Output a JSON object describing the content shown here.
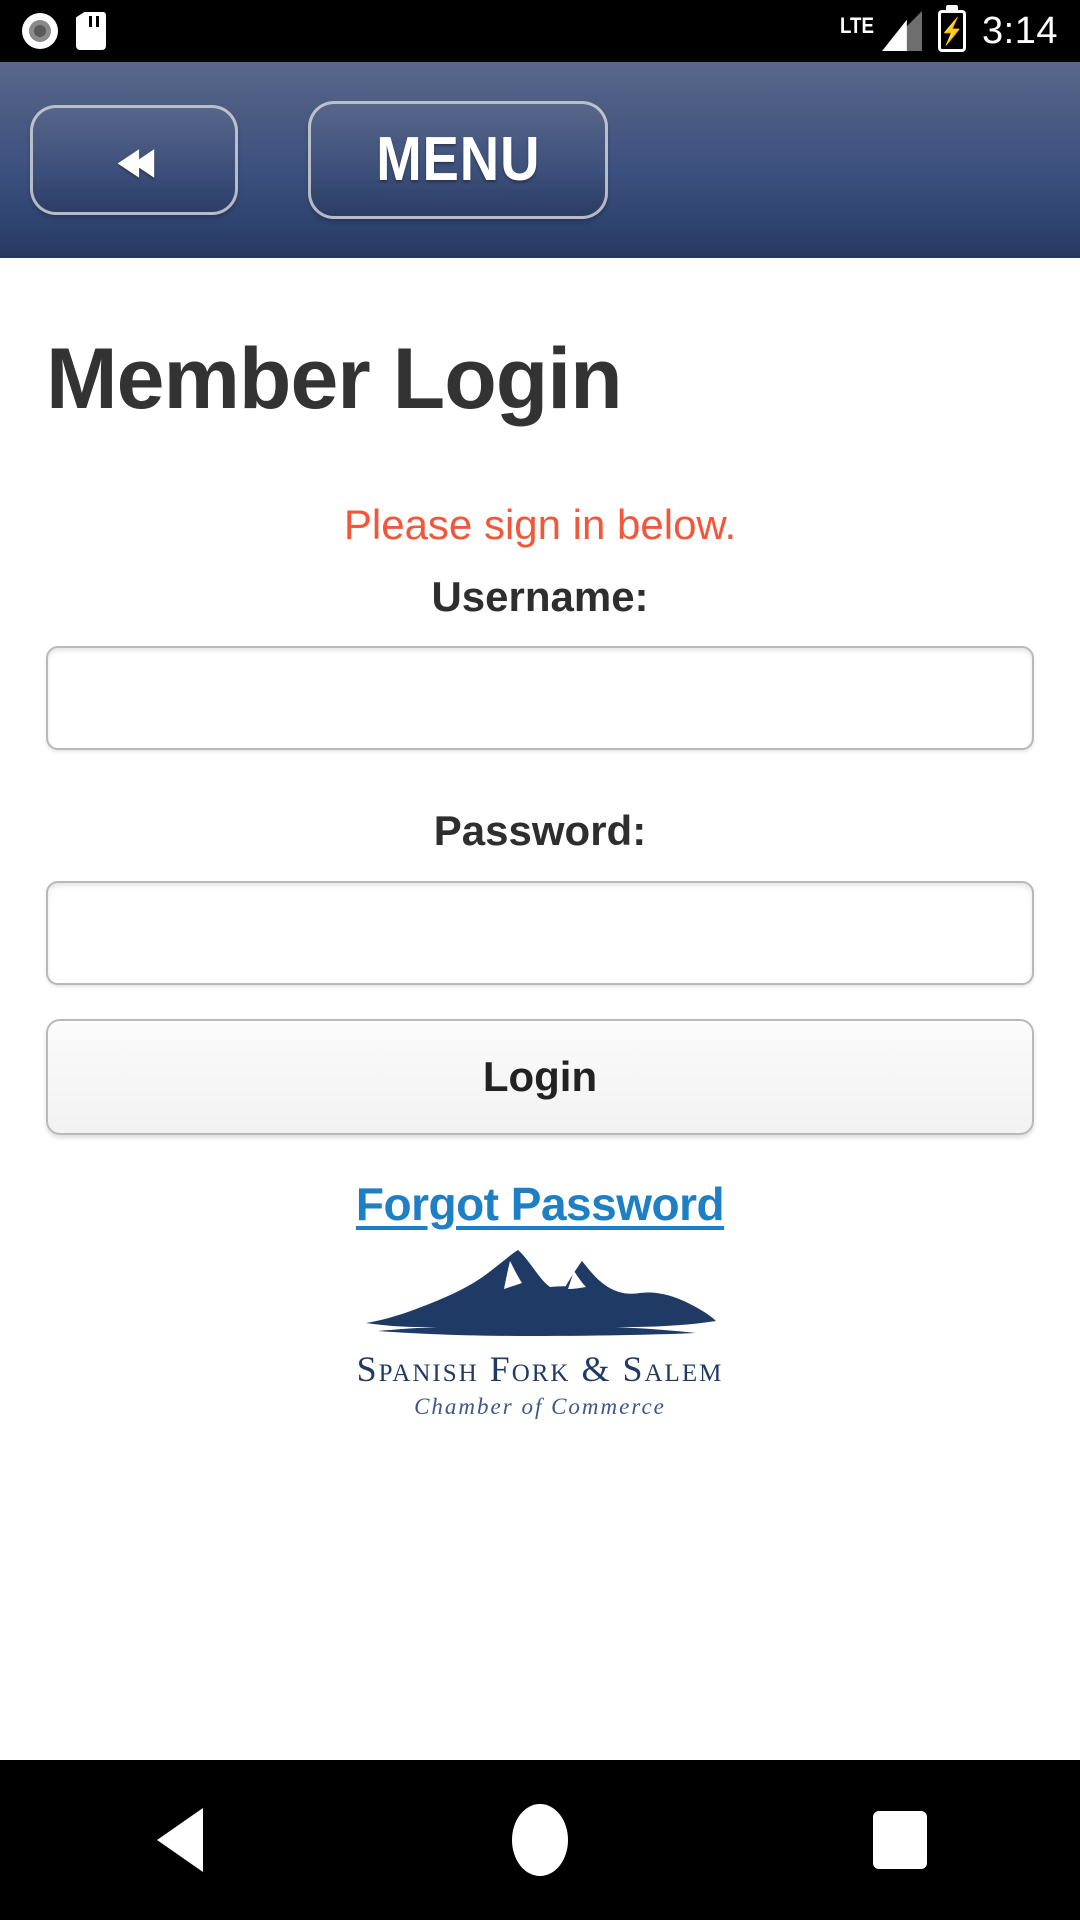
{
  "status_bar": {
    "icons_left": [
      "record-dot-icon",
      "sd-card-icon"
    ],
    "network_type": "LTE",
    "signal_icon": "signal-bars-icon",
    "battery_icon": "battery-charging-icon",
    "battery_glyph": "⚡",
    "time": "3:14"
  },
  "app_bar": {
    "back_label": "◂◂",
    "back_name": "back",
    "menu_label": "MENU"
  },
  "main": {
    "page_title": "Member Login",
    "notice": "Please sign in below.",
    "username_label": "Username:",
    "username_value": "",
    "username_placeholder": "",
    "password_label": "Password:",
    "password_value": "",
    "password_placeholder": "",
    "login_button": "Login",
    "forgot_link": "Forgot Password"
  },
  "logo": {
    "icon": "mountain-range-icon",
    "name": "Spanish Fork & Salem",
    "subtitle": "Chamber of Commerce"
  },
  "nav_bar": {
    "back": "back-triangle-icon",
    "home": "home-circle-icon",
    "recents": "recents-square-icon"
  },
  "colors": {
    "header_top": "#59688c",
    "header_bottom": "#26395e",
    "notice": "#f1583a",
    "link": "#1f7fc4",
    "title": "#333333",
    "logo": "#203a66"
  }
}
